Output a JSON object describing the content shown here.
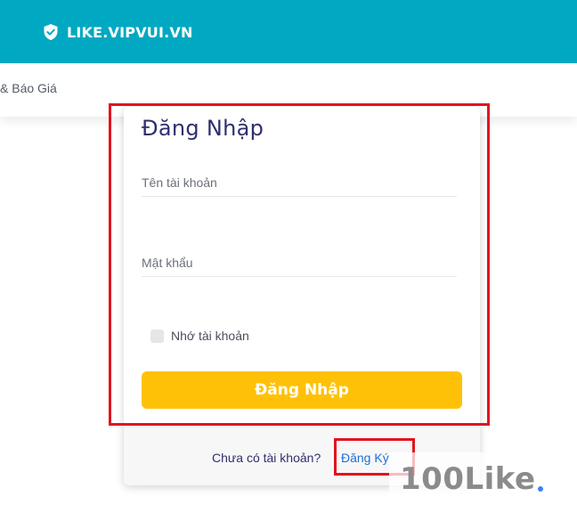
{
  "header": {
    "brand": "LIKE.VIPVUI.VN",
    "brand_icon": "shield-check-icon",
    "bg_color": "#00a9c1"
  },
  "subnav": {
    "text": "& Báo Giá"
  },
  "login": {
    "title": "Đăng Nhập",
    "username_placeholder": "Tên tài khoản",
    "password_placeholder": "Mật khẩu",
    "remember_label": "Nhớ tài khoản",
    "remember_checked": false,
    "submit_label": "Đăng Nhập",
    "button_color": "#ffc107",
    "footer_prompt": "Chưa có tài khoản?",
    "register_link": "Đăng Ký",
    "link_color": "#1f6fd6"
  },
  "annotation": {
    "highlight_color": "#e1141e"
  },
  "watermark": {
    "text": "100Like"
  }
}
